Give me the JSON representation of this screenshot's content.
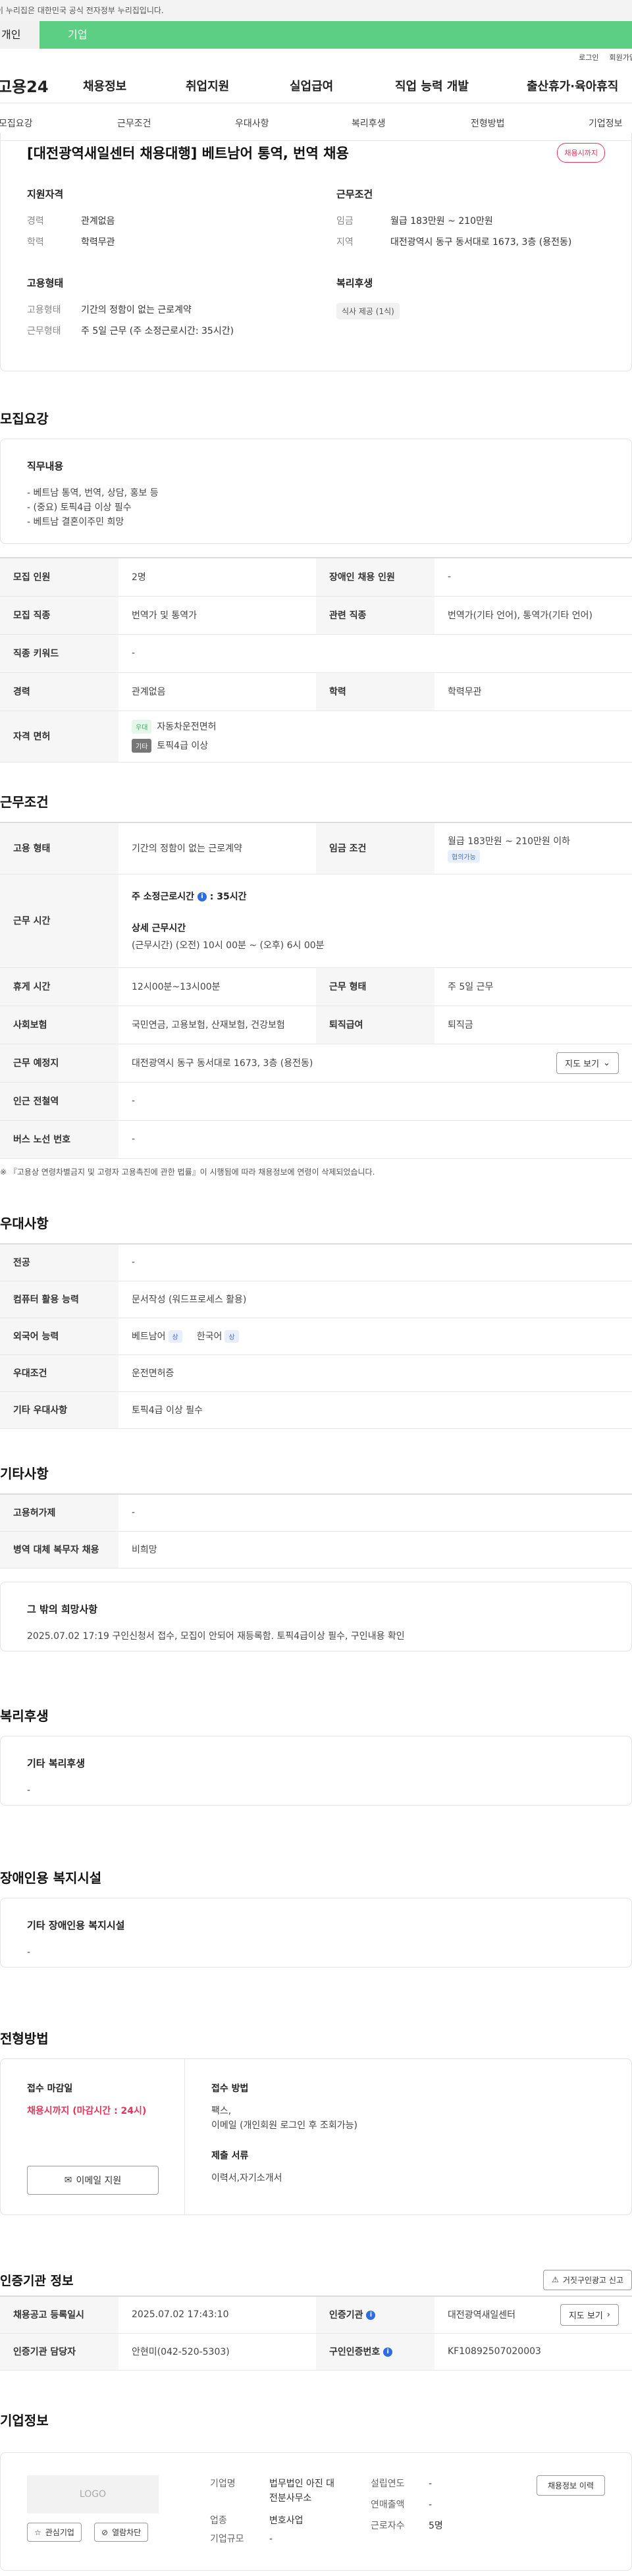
{
  "gov_banner": "이 누리집은 대한민국 공식 전자정부 누리집입니다.",
  "user_tabs": {
    "individual": "개인",
    "enterprise": "기업"
  },
  "util_links": [
    "로그인",
    "회원가입"
  ],
  "gnb": {
    "logo": "고용24",
    "items": [
      "채용정보",
      "취업지원",
      "실업급여",
      "직업 능력 개발",
      "출산휴가·육아휴직"
    ]
  },
  "anchor_tabs": [
    "모집요강",
    "근무조건",
    "우대사항",
    "복리후생",
    "전형방법",
    "기업정보"
  ],
  "summary": {
    "title": "[대전광역새일센터 채용대행] 베트남어 통역, 번역 채용",
    "badge": "채용시까지",
    "qual_head": "지원자격",
    "career_k": "경력",
    "career_v": "관계없음",
    "edu_k": "학력",
    "edu_v": "학력무관",
    "emp_head": "고용형태",
    "emptype_k": "고용형태",
    "emptype_v": "기간의 정함이 없는 근로계약",
    "worktype_k": "근무형태",
    "worktype_v": "주 5일 근무 (주 소정근로시간: 35시간)",
    "cond_head": "근무조건",
    "wage_k": "임금",
    "wage_v": "월급 183만원 ~ 210만원",
    "region_k": "지역",
    "region_v": "대전광역시 동구 동서대로 1673, 3층 (용전동)",
    "welfare_head": "복리후생",
    "welfare_pill": "식사 제공 (1식)"
  },
  "recruit": {
    "section": "모집요강",
    "duty_head": "직무내용",
    "duty_lines": [
      "- 베트남 통역, 번역, 상담, 홍보 등",
      "- (중요) 토픽4급 이상 필수",
      "- 베트남 결혼이주민 희망"
    ],
    "rows": {
      "count_k": "모집 인원",
      "count_v": "2명",
      "disabled_k": "장애인 채용 인원",
      "disabled_v": "-",
      "job_k": "모집 직종",
      "job_v": "번역가 및 통역가",
      "related_k": "관련 직종",
      "related_v": "번역가(기타 언어), 통역가(기타 언어)",
      "kw_k": "직종 키워드",
      "kw_v": "-",
      "career_k": "경력",
      "career_v": "관계없음",
      "edu_k": "학력",
      "edu_v": "학력무관",
      "lic_k": "자격 면허",
      "lic1_tag": "우대",
      "lic1_v": "자동차운전면허",
      "lic2_tag": "기타",
      "lic2_v": "토픽4급 이상"
    }
  },
  "work": {
    "section": "근무조건",
    "emptype_k": "고용 형태",
    "emptype_v": "기간의 정함이 없는 근로계약",
    "wage_k": "임금 조건",
    "wage_v": "월급 183만원 ~ 210만원 이하",
    "wage_tag": "협의가능",
    "hours_k": "근무 시간",
    "hours_l1a": "주 소정근로시간",
    "hours_l1b": ": 35시간",
    "hours_l2": "상세 근무시간",
    "hours_l3": "(근무시간) (오전) 10시 00분 ~ (오후) 6시 00분",
    "rest_k": "휴게 시간",
    "rest_v": "12시00분~13시00분",
    "form_k": "근무 형태",
    "form_v": "주 5일 근무",
    "ins_k": "사회보험",
    "ins_v": "국민연금, 고용보험, 산재보험, 건강보험",
    "retire_k": "퇴직급여",
    "retire_v": "퇴직금",
    "place_k": "근무 예정지",
    "place_v": "대전광역시 동구 동서대로 1673, 3층 (용전동)",
    "map_btn": "지도 보기",
    "subway_k": "인근 전철역",
    "subway_v": "-",
    "bus_k": "버스 노선 번호",
    "bus_v": "-",
    "note": "※ 『고용상 연령차별금지 및 고령자 고용촉진에 관한 법률』이 시행됨에 따라 채용정보에 연령이 삭제되었습니다."
  },
  "pref": {
    "section": "우대사항",
    "major_k": "전공",
    "major_v": "-",
    "pc_k": "컴퓨터 활용 능력",
    "pc_v": "문서작성 (워드프로세스 활용)",
    "lang_k": "외국어 능력",
    "lang1": "베트남어",
    "lang2": "한국어",
    "lang_tag": "상",
    "cond_k": "우대조건",
    "cond_v": "운전면허증",
    "etc_k": "기타 우대사항",
    "etc_v": "토픽4급 이상 필수"
  },
  "etc": {
    "section": "기타사항",
    "permit_k": "고용허가제",
    "permit_v": "-",
    "army_k": "병역 대체 복무자 채용",
    "army_v": "비희망",
    "hope_head": "그 밖의 희망사항",
    "hope_v": "2025.07.02 17:19 구인신청서 접수, 모집이 안되어 재등록함. 토픽4급이상 필수, 구인내용 확인"
  },
  "welfare": {
    "section": "복리후생",
    "head": "기타 복리후생",
    "v": "-"
  },
  "disabled": {
    "section": "장애인용 복지시설",
    "head": "기타 장애인용 복지시설",
    "v": "-"
  },
  "process": {
    "section": "전형방법",
    "deadline_head": "접수 마감일",
    "deadline_v": "채용시까지 (마감시간 : 24시)",
    "email_btn": "이메일 지원",
    "method_head": "접수 방법",
    "method_l1": "팩스,",
    "method_l2": "이메일 (개인회원 로그인 후 조회가능)",
    "docs_head": "제출 서류",
    "docs_v": "이력서,자기소개서"
  },
  "cert": {
    "section": "인증기관 정보",
    "report_btn": "거짓구인광고 신고",
    "reg_k": "채용공고 등록일시",
    "reg_v": "2025.07.02 17:43:10",
    "org_k": "인증기관",
    "org_v": "대전광역새일센터",
    "map_btn": "지도 보기",
    "mgr_k": "인증기관 담당자",
    "mgr_v": "안현미(042-520-5303)",
    "no_k": "구인인증번호",
    "no_v": "KF10892507020003"
  },
  "company": {
    "section": "기업정보",
    "logo_text": "LOGO",
    "fav_btn": "관심기업",
    "block_btn": "열람차단",
    "name_k": "기업명",
    "name_v1": "법무법인 아진 대",
    "name_v2": "전분사무소",
    "industry_k": "업종",
    "industry_v": "변호사업",
    "scale_k": "기업규모",
    "scale_v": "-",
    "year_k": "설립연도",
    "year_v": "-",
    "sales_k": "연매출액",
    "sales_v": "-",
    "staff_k": "근로자수",
    "staff_v": "5명",
    "hist_btn": "채용정보 이력"
  }
}
